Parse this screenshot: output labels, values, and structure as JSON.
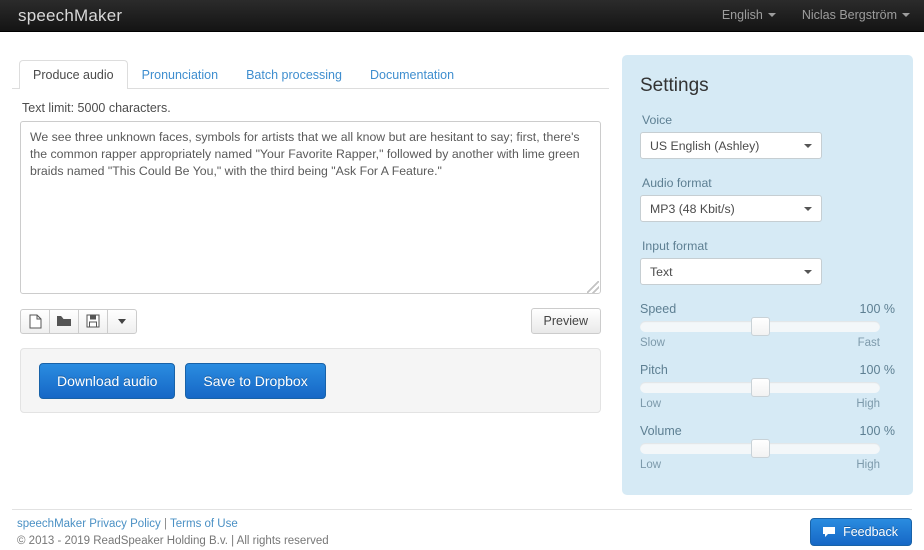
{
  "navbar": {
    "brand": "speechMaker",
    "language": "English",
    "user": "Niclas Bergström"
  },
  "tabs": [
    {
      "label": "Produce audio",
      "active": true
    },
    {
      "label": "Pronunciation",
      "active": false
    },
    {
      "label": "Batch processing",
      "active": false
    },
    {
      "label": "Documentation",
      "active": false
    }
  ],
  "editor": {
    "text_limit": "Text limit: 5000 characters.",
    "content": "We see three unknown faces, symbols for artists that we all know but are hesitant to say; first, there's the common rapper appropriately named \"Your Favorite Rapper,\" followed by another with lime green braids named \"This Could Be You,\" with the third being \"Ask For A Feature.\"",
    "placeholder": ""
  },
  "toolbar": {
    "new_icon": "new-document-icon",
    "open_icon": "open-folder-icon",
    "save_icon": "save-floppy-icon",
    "more_icon": "caret-down-icon",
    "preview_label": "Preview"
  },
  "actions": {
    "download_label": "Download audio",
    "dropbox_label": "Save to Dropbox"
  },
  "settings": {
    "title": "Settings",
    "voice": {
      "label": "Voice",
      "value": "US English (Ashley)"
    },
    "audio_format": {
      "label": "Audio format",
      "value": "MP3 (48 Kbit/s)"
    },
    "input_format": {
      "label": "Input format",
      "value": "Text"
    },
    "sliders": [
      {
        "label": "Speed",
        "value": "100 %",
        "min_label": "Slow",
        "max_label": "Fast",
        "position": 50
      },
      {
        "label": "Pitch",
        "value": "100 %",
        "min_label": "Low",
        "max_label": "High",
        "position": 50
      },
      {
        "label": "Volume",
        "value": "100 %",
        "min_label": "Low",
        "max_label": "High",
        "position": 50
      }
    ]
  },
  "footer": {
    "privacy_link": "speechMaker Privacy Policy",
    "separator": "|",
    "terms_link": "Terms of Use",
    "copyright": "© 2013 - 2019 ReadSpeaker Holding B.v. | All rights reserved",
    "feedback_label": "Feedback",
    "feedback_icon": "speech-bubble-icon"
  },
  "colors": {
    "navbar_bg": "#1f1f1f",
    "primary_blue": "#1e7ad4",
    "settings_bg": "#d6eaf5",
    "link_blue": "#3f8ecf"
  }
}
